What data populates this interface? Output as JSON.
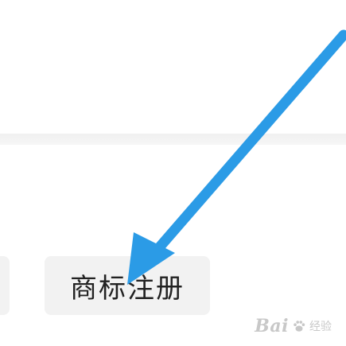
{
  "menu": {
    "trademark_registration_label": "商标注册"
  },
  "watermark": {
    "brand": "Bai",
    "sub": "经验"
  },
  "colors": {
    "arrow": "#2b9be6",
    "button_bg": "#f2f2f2",
    "text": "#222222",
    "band": "#f3f3f3"
  },
  "icons": {
    "annotation_arrow": "arrow-down-left-icon",
    "watermark_paw": "baidu-paw-icon"
  }
}
